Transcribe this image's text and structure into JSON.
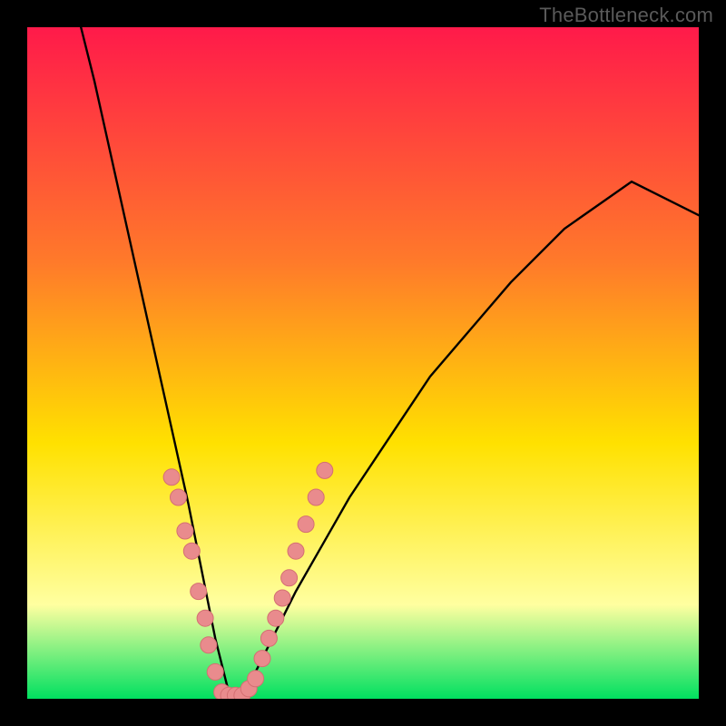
{
  "watermark": "TheBottleneck.com",
  "colors": {
    "frame": "#000000",
    "gradient_top": "#ff1a4a",
    "gradient_mid1": "#ff7a2a",
    "gradient_mid2": "#ffe100",
    "gradient_low": "#ffffa0",
    "gradient_bottom": "#00e060",
    "curve": "#000000",
    "marker_fill": "#e98b8d",
    "marker_stroke": "#d46f72"
  },
  "chart_data": {
    "type": "line",
    "title": "",
    "xlabel": "",
    "ylabel": "",
    "xlim": [
      0,
      100
    ],
    "ylim": [
      0,
      100
    ],
    "series": [
      {
        "name": "bottleneck-curve",
        "note": "V-shaped curve; y≈100 at edges, y≈0 at minimum near x≈30. Values estimated from pixels.",
        "x": [
          8,
          10,
          12,
          14,
          16,
          18,
          20,
          22,
          24,
          26,
          28,
          30,
          32,
          34,
          36,
          38,
          40,
          44,
          48,
          52,
          56,
          60,
          66,
          72,
          80,
          90,
          100
        ],
        "y": [
          100,
          92,
          83,
          74,
          65,
          56,
          47,
          38,
          29,
          19,
          9,
          1,
          1,
          4,
          8,
          12,
          16,
          23,
          30,
          36,
          42,
          48,
          55,
          62,
          70,
          77,
          72
        ]
      }
    ],
    "markers": {
      "name": "highlight-dots",
      "note": "Pink dots clustered on both legs of the V near the bottom, roughly y in [0,30].",
      "points": [
        [
          21.5,
          33
        ],
        [
          22.5,
          30
        ],
        [
          23.5,
          25
        ],
        [
          24.5,
          22
        ],
        [
          25.5,
          16
        ],
        [
          26.5,
          12
        ],
        [
          27.0,
          8
        ],
        [
          28.0,
          4
        ],
        [
          29.0,
          1
        ],
        [
          30.0,
          0.5
        ],
        [
          31.0,
          0.5
        ],
        [
          32.0,
          0.5
        ],
        [
          33.0,
          1.5
        ],
        [
          34.0,
          3
        ],
        [
          35.0,
          6
        ],
        [
          36.0,
          9
        ],
        [
          37.0,
          12
        ],
        [
          38.0,
          15
        ],
        [
          39.0,
          18
        ],
        [
          40.0,
          22
        ],
        [
          41.5,
          26
        ],
        [
          43.0,
          30
        ],
        [
          44.3,
          34
        ]
      ]
    }
  }
}
